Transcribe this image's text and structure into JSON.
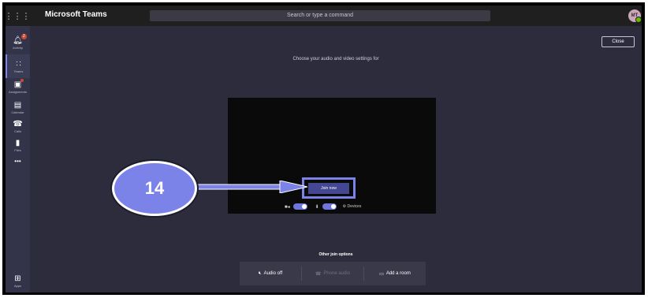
{
  "app": {
    "title": "Microsoft Teams",
    "search_placeholder": "Search or type a command",
    "avatar_initials": "MT"
  },
  "rail": {
    "items": [
      {
        "label": "Activity",
        "badge": "2"
      },
      {
        "label": "Teams"
      },
      {
        "label": "Assignments"
      },
      {
        "label": "Calendar"
      },
      {
        "label": "Calls"
      },
      {
        "label": "Files"
      },
      {
        "label": "•••"
      }
    ],
    "bottom": [
      {
        "label": "Apps"
      }
    ]
  },
  "prejoin": {
    "close_label": "Close",
    "heading": "Choose your audio and video settings for",
    "join_label": "Join now",
    "camera_on": true,
    "mic_on": true,
    "devices_label": "Devices"
  },
  "annotation": {
    "step_number": "14",
    "accent": "#7b82e8"
  },
  "other_options": {
    "title": "Other join options",
    "items": [
      {
        "label": "Audio off",
        "enabled": true
      },
      {
        "label": "Phone audio",
        "enabled": false
      },
      {
        "label": "Add a room",
        "enabled": true
      }
    ]
  }
}
